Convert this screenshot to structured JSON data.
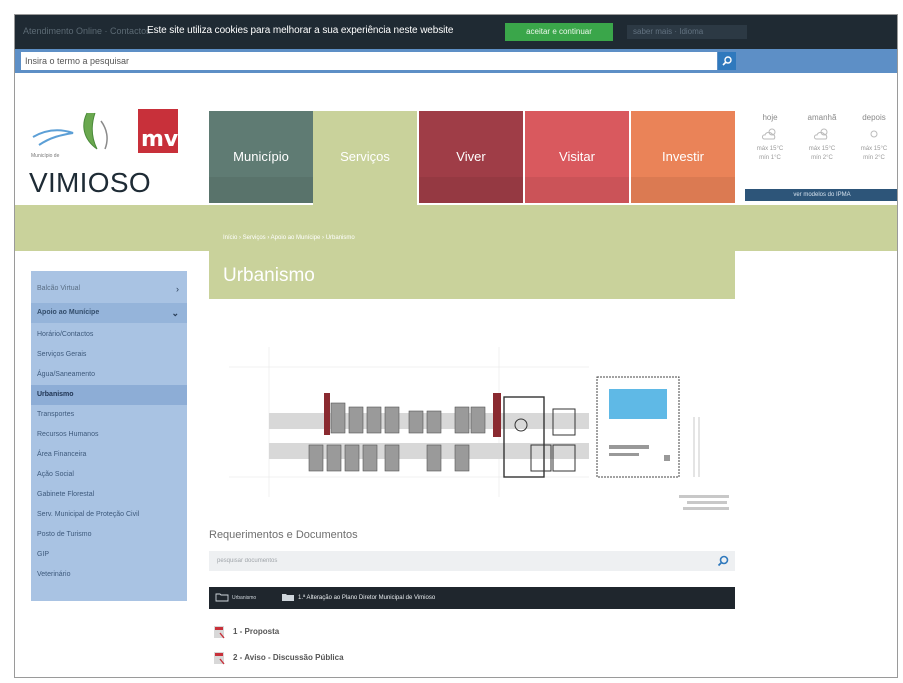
{
  "cookie_bar": {
    "ghost_left": "Atendimento Online · Contactos",
    "message": "Este site utiliza cookies para melhorar a sua experiência neste website",
    "accept_label": "aceitar e continuar",
    "ghost_right": "saber mais · Idioma"
  },
  "search": {
    "placeholder": "Insira o termo a pesquisar"
  },
  "logo": {
    "monogram": "mv",
    "municipio": "Município de",
    "name": "VIMIOSO"
  },
  "nav": [
    {
      "label": "Município",
      "color": "#5f7b73"
    },
    {
      "label": "Serviços",
      "color": "#c9d29b"
    },
    {
      "label": "Viver",
      "color": "#9f3d47"
    },
    {
      "label": "Visitar",
      "color": "#d9595e"
    },
    {
      "label": "Investir",
      "color": "#ea8358"
    }
  ],
  "weather": {
    "days": [
      {
        "day": "hoje",
        "max": "máx 15°C",
        "min": "mín 1°C"
      },
      {
        "day": "amanhã",
        "max": "máx 15°C",
        "min": "mín 2°C"
      },
      {
        "day": "depois",
        "max": "máx 15°C",
        "min": "mín 2°C"
      }
    ],
    "forecast_link": "ver modelos do IPMA"
  },
  "breadcrumb": "Início › Serviços › Apoio ao Munícipe › Urbanismo",
  "page_title": "Urbanismo",
  "sidebar": [
    {
      "label": "Balcão Virtual",
      "chev": "›"
    },
    {
      "label": "Apoio ao Munícipe",
      "chev": "⌄"
    },
    {
      "label": "Horário/Contactos"
    },
    {
      "label": "Serviços Gerais"
    },
    {
      "label": "Água/Saneamento"
    },
    {
      "label": "Urbanismo"
    },
    {
      "label": "Transportes"
    },
    {
      "label": "Recursos Humanos"
    },
    {
      "label": "Área Financeira"
    },
    {
      "label": "Ação Social"
    },
    {
      "label": "Gabinete Florestal"
    },
    {
      "label": "Serv. Municipal de Proteção Civil"
    },
    {
      "label": "Posto de Turismo"
    },
    {
      "label": "GIP"
    },
    {
      "label": "Veterinário"
    }
  ],
  "docs": {
    "title": "Requerimentos e Documentos",
    "search_placeholder": "pesquisar documentos",
    "folder_root": "Urbanismo",
    "folder_current": "1.ª Alteração ao Plano Diretor Municipal de Vimioso",
    "files": [
      "1 - Proposta",
      "2 - Aviso - Discussão Pública"
    ]
  },
  "colors": {
    "cookie_bg": "#1f2a33",
    "accept_green": "#3aa64a",
    "search_blue": "#5d8fc6",
    "olive": "#c9d29b",
    "sidebar_blue": "#a9c3e3",
    "folder_bar": "#1f262d"
  }
}
